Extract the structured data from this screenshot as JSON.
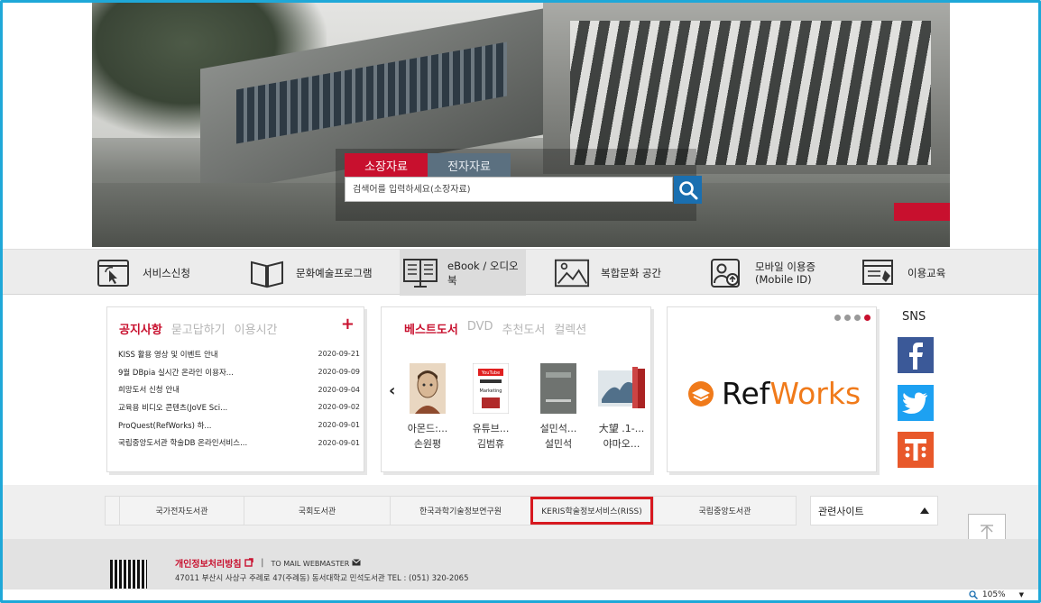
{
  "search": {
    "tabs": [
      "소장자료",
      "전자자료"
    ],
    "placeholder": "검색어를 입력하세요(소장자료)"
  },
  "menu": [
    {
      "label": "서비스신청",
      "icon": "cursor-click-icon"
    },
    {
      "label": "문화예술프로그램",
      "icon": "open-book-icon"
    },
    {
      "label": "eBook / 오디오북",
      "icon": "ebook-monitor-icon"
    },
    {
      "label": "복합문화 공간",
      "icon": "picture-icon"
    },
    {
      "label": "모바일 이용증",
      "sub": "(Mobile ID)",
      "icon": "mobile-id-icon"
    },
    {
      "label": "이용교육",
      "icon": "education-icon"
    }
  ],
  "notice": {
    "tabs": [
      "공지사항",
      "묻고답하기",
      "이용시간"
    ],
    "plus": "+",
    "rows": [
      {
        "title": "KISS 활용 영상 및 이벤트 안내",
        "date": "2020-09-21"
      },
      {
        "title": "9월 DBpia 실시간 온라인 이용자...",
        "date": "2020-09-09"
      },
      {
        "title": "희망도서 신청 안내",
        "date": "2020-09-04"
      },
      {
        "title": "교육용 비디오 콘텐츠(JoVE Sci...",
        "date": "2020-09-02"
      },
      {
        "title": "ProQuest(RefWorks) 하...",
        "date": "2020-09-01"
      },
      {
        "title": "국립중앙도서관 학술DB 온라인서비스...",
        "date": "2020-09-01"
      }
    ]
  },
  "books": {
    "tabs": [
      "베스트도서",
      "DVD",
      "추천도서",
      "컬렉션"
    ],
    "prev": "‹",
    "next": "›",
    "cover_texts": [
      "YouTube",
      "Marketing"
    ],
    "items": [
      {
        "title": "아몬드:...",
        "author": "손원평"
      },
      {
        "title": "유튜브...",
        "author": "김범휴"
      },
      {
        "title": "설민석...",
        "author": "설민석"
      },
      {
        "title": "大望 .1-...",
        "author": "야마오..."
      }
    ]
  },
  "banner": {
    "brand": "RefWorks",
    "brand_parts": [
      "Ref",
      "Works"
    ],
    "dot_count": 4,
    "active_dot": 3
  },
  "sns": {
    "title": "SNS",
    "items": [
      "facebook-icon",
      "twitter-icon",
      "kakaostory-icon"
    ]
  },
  "related": {
    "links": [
      "국가전자도서관",
      "국회도서관",
      "한국과학기술정보연구원",
      "KERIS학술정보서비스(RISS)",
      "국립중앙도서관"
    ],
    "highlighted": 3,
    "select_label": "관련사이트",
    "top_button": "⊤"
  },
  "footer": {
    "privacy": "개인정보처리방침",
    "mail": "TO MAIL WEBMASTER",
    "address": "47011 부산시 사상구 주례로 47(주례동) 동서대학교 민석도서관 TEL : (051) 320-2065"
  },
  "status": {
    "zoom": "105%"
  },
  "colors": {
    "accent": "#c8102e",
    "frame": "#1fa8d8",
    "search_button": "#1a6fb0",
    "refworks_orange": "#f07a1a"
  }
}
